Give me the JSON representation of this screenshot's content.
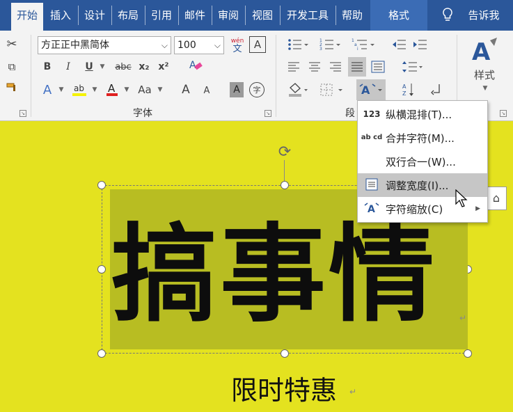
{
  "tabs": [
    "开始",
    "插入",
    "设计",
    "布局",
    "引用",
    "邮件",
    "审阅",
    "视图",
    "开发工具",
    "帮助",
    "格式"
  ],
  "tell_me": "告诉我",
  "font": {
    "name": "方正正中黑简体",
    "size": "100",
    "group_label": "字体",
    "buttons": {
      "bold": "B",
      "italic": "I",
      "underline": "U",
      "strike": "abc",
      "subscript": "x₂",
      "superscript": "x²",
      "aa": "Aa",
      "grow": "A",
      "shrink": "A",
      "char_shade": "A",
      "enclose": "字",
      "phonetic_top": "wén",
      "phonetic_bottom": "文",
      "char_border": "A"
    }
  },
  "paragraph": {
    "group_label": "段"
  },
  "styles": {
    "label": "样式"
  },
  "menu": {
    "items": [
      {
        "icon": "123",
        "label": "纵横混排(T)..."
      },
      {
        "icon": "ab cd",
        "label": "合并字符(M)..."
      },
      {
        "icon": "",
        "label": "双行合一(W)..."
      },
      {
        "icon": "",
        "label": "调整宽度(I)..."
      },
      {
        "icon": "",
        "label": "字符缩放(C)"
      }
    ]
  },
  "document": {
    "headline": "搞事情",
    "subtitle": "限时特惠"
  },
  "colors": {
    "ribbon_tab_bg": "#2b579a",
    "page_bg": "#e4e21f",
    "text_highlight": "#b8bd22"
  }
}
